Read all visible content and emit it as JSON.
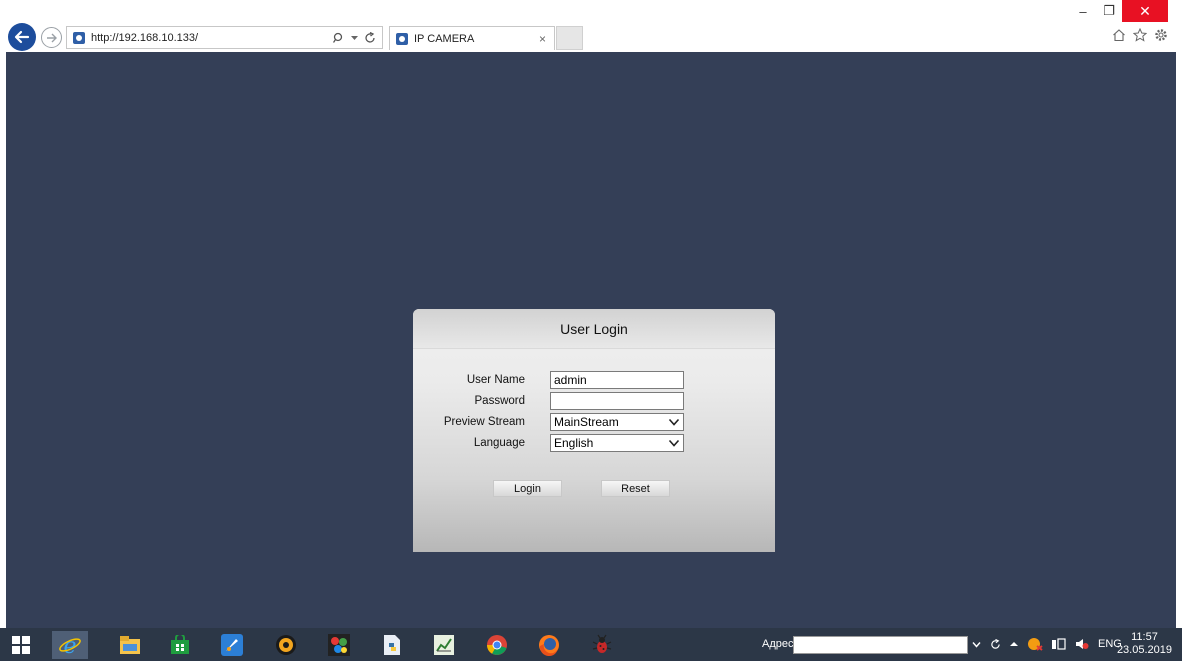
{
  "browser": {
    "url": "http://192.168.10.133/",
    "tab_title": "IP CAMERA",
    "tab_close": "×",
    "icons": [
      "back-arrow-icon",
      "forward-arrow-icon",
      "search-icon",
      "refresh-icon",
      "home-icon",
      "favorites-star-icon",
      "settings-gear-icon"
    ],
    "window_controls": {
      "minimize": "–",
      "restore": "❐",
      "close": "✕"
    }
  },
  "login": {
    "title": "User Login",
    "fields": {
      "username_label": "User Name",
      "username_value": "admin",
      "password_label": "Password",
      "password_value": "",
      "stream_label": "Preview Stream",
      "stream_value": "MainStream",
      "language_label": "Language",
      "language_value": "English"
    },
    "login_button": "Login",
    "reset_button": "Reset"
  },
  "taskbar": {
    "apps": [
      "internet-explorer-icon",
      "file-explorer-icon",
      "store-icon",
      "rocket-app-icon",
      "media-player-icon",
      "paint-app-icon",
      "python-app-icon",
      "chart-app-icon",
      "chrome-icon",
      "firefox-icon",
      "bug-app-icon"
    ],
    "address_label": "Адрес",
    "tray_language": "ENG",
    "time": "11:57",
    "date": "23.05.2019"
  },
  "colors": {
    "page_background": "#343f57",
    "taskbar": "#2c3747",
    "close_button": "#e81123",
    "back_button": "#1d4d9c"
  }
}
